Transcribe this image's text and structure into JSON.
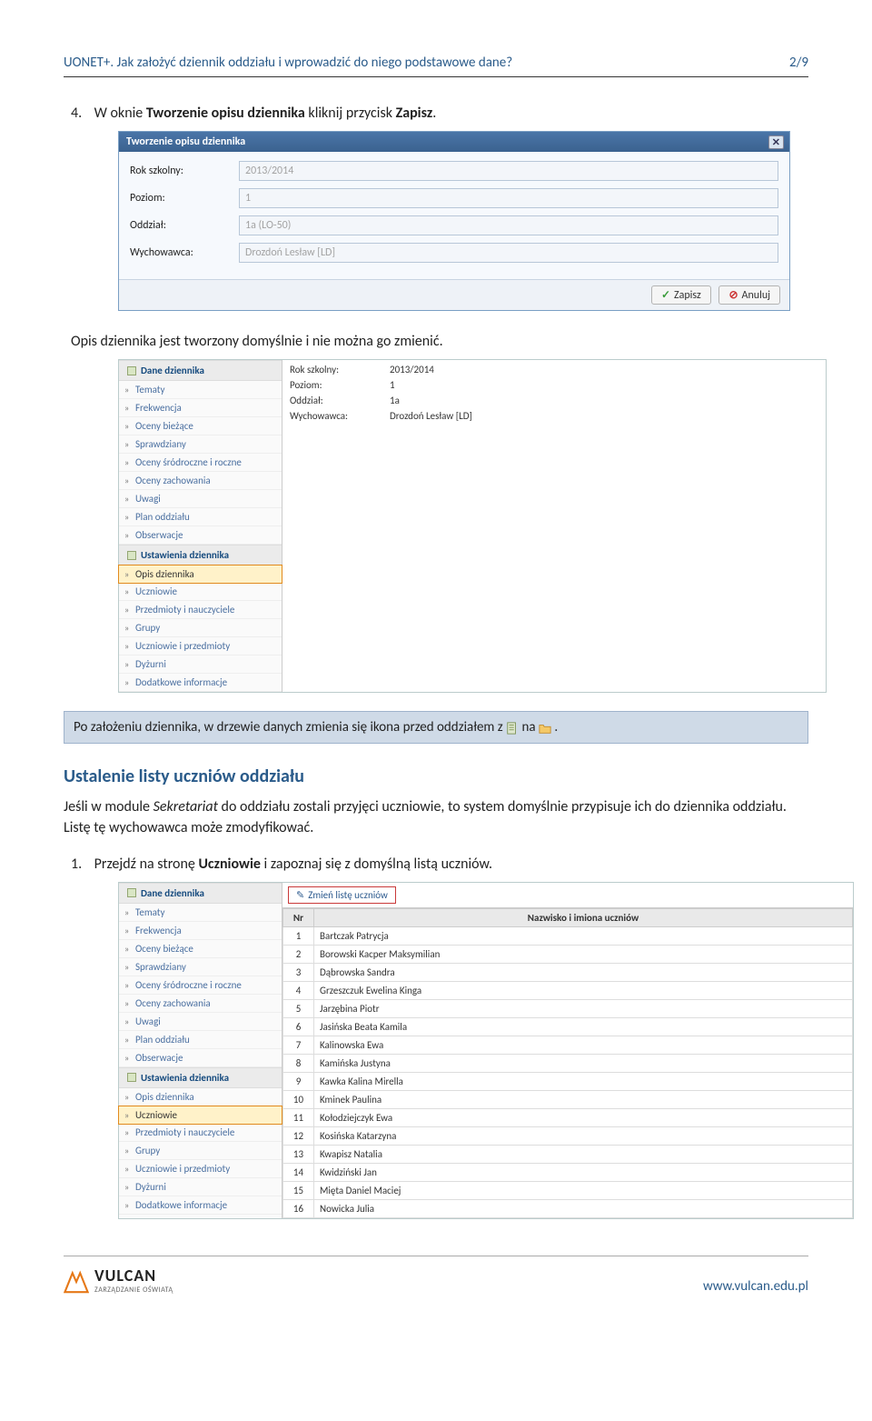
{
  "doc": {
    "header_left": "UONET+. Jak założyć dziennik oddziału i wprowadzić do niego podstawowe dane?",
    "header_right": "2/9"
  },
  "step4_prefix": "4.",
  "step4_text_before": "W oknie ",
  "step4_bold1": "Tworzenie opisu dziennika",
  "step4_text_mid": " kliknij przycisk ",
  "step4_bold2": "Zapisz",
  "step4_text_end": ".",
  "dialog": {
    "title": "Tworzenie opisu dziennika",
    "close": "✕",
    "rows": {
      "rok_label": "Rok szkolny:",
      "rok_value": "2013/2014",
      "poziom_label": "Poziom:",
      "poziom_value": "1",
      "oddzial_label": "Oddział:",
      "oddzial_value": "1a (LO-50)",
      "wych_label": "Wychowawca:",
      "wych_value": "Drozdoń Lesław [LD]"
    },
    "save": "Zapisz",
    "cancel": "Anuluj"
  },
  "after_dialog_text": "Opis dziennika jest tworzony domyślnie i nie można go zmienić.",
  "shot1": {
    "groups": [
      {
        "title": "Dane dziennika",
        "items": [
          "Tematy",
          "Frekwencja",
          "Oceny bieżące",
          "Sprawdziany",
          "Oceny śródroczne i roczne",
          "Oceny zachowania",
          "Uwagi",
          "Plan oddziału",
          "Obserwacje"
        ]
      },
      {
        "title": "Ustawienia dziennika",
        "selected_index": 0,
        "items": [
          "Opis dziennika",
          "Uczniowie",
          "Przedmioty i nauczyciele",
          "Grupy",
          "Uczniowie i przedmioty",
          "Dyżurni",
          "Dodatkowe informacje"
        ]
      }
    ],
    "detail": [
      {
        "k": "Rok szkolny:",
        "v": "2013/2014"
      },
      {
        "k": "Poziom:",
        "v": "1"
      },
      {
        "k": "Oddział:",
        "v": "1a"
      },
      {
        "k": "Wychowawca:",
        "v": "Drozdoń Lesław [LD]"
      }
    ]
  },
  "blue_note_text_a": "Po założeniu dziennika, w drzewie danych zmienia się ikona przed oddziałem z ",
  "blue_note_text_b": " na ",
  "blue_note_text_c": ".",
  "section_heading": "Ustalenie listy uczniów oddziału",
  "body_para": "Jeśli w module Sekretariat do oddziału zostali przyjęci uczniowie, to system domyślnie przypisuje ich do dziennika oddziału. Listę tę wychowawca może zmodyfikować.",
  "step1_prefix": "1.",
  "step1_text_before": "Przejdź na stronę ",
  "step1_bold": "Uczniowie",
  "step1_text_after": " i zapoznaj się z domyślną listą uczniów.",
  "shot2": {
    "button": "Zmień listę uczniów",
    "nr_header": "Nr",
    "name_header": "Nazwisko i imiona uczniów",
    "rows": [
      {
        "nr": "1",
        "name": "Bartczak Patrycja"
      },
      {
        "nr": "2",
        "name": "Borowski Kacper Maksymilian"
      },
      {
        "nr": "3",
        "name": "Dąbrowska Sandra"
      },
      {
        "nr": "4",
        "name": "Grzeszczuk Ewelina Kinga"
      },
      {
        "nr": "5",
        "name": "Jarzębina Piotr"
      },
      {
        "nr": "6",
        "name": "Jasińska Beata Kamila"
      },
      {
        "nr": "7",
        "name": "Kalinowska Ewa"
      },
      {
        "nr": "8",
        "name": "Kamińska Justyna"
      },
      {
        "nr": "9",
        "name": "Kawka Kalina Mirella"
      },
      {
        "nr": "10",
        "name": "Kminek Paulina"
      },
      {
        "nr": "11",
        "name": "Kołodziejczyk Ewa"
      },
      {
        "nr": "12",
        "name": "Kosińska Katarzyna"
      },
      {
        "nr": "13",
        "name": "Kwapisz Natalia"
      },
      {
        "nr": "14",
        "name": "Kwidziński Jan"
      },
      {
        "nr": "15",
        "name": "Mięta Daniel Maciej"
      },
      {
        "nr": "16",
        "name": "Nowicka Julia"
      }
    ],
    "nav_groups": [
      {
        "title": "Dane dziennika",
        "items": [
          "Tematy",
          "Frekwencja",
          "Oceny bieżące",
          "Sprawdziany",
          "Oceny śródroczne i roczne",
          "Oceny zachowania",
          "Uwagi",
          "Plan oddziału",
          "Obserwacje"
        ]
      },
      {
        "title": "Ustawienia dziennika",
        "selected_index": 1,
        "items": [
          "Opis dziennika",
          "Uczniowie",
          "Przedmioty i nauczyciele",
          "Grupy",
          "Uczniowie i przedmioty",
          "Dyżurni",
          "Dodatkowe informacje"
        ]
      }
    ]
  },
  "footer": {
    "brand": "VULCAN",
    "tagline": "ZARZĄDZANIE OŚWIATĄ",
    "url": "www.vulcan.edu.pl"
  }
}
